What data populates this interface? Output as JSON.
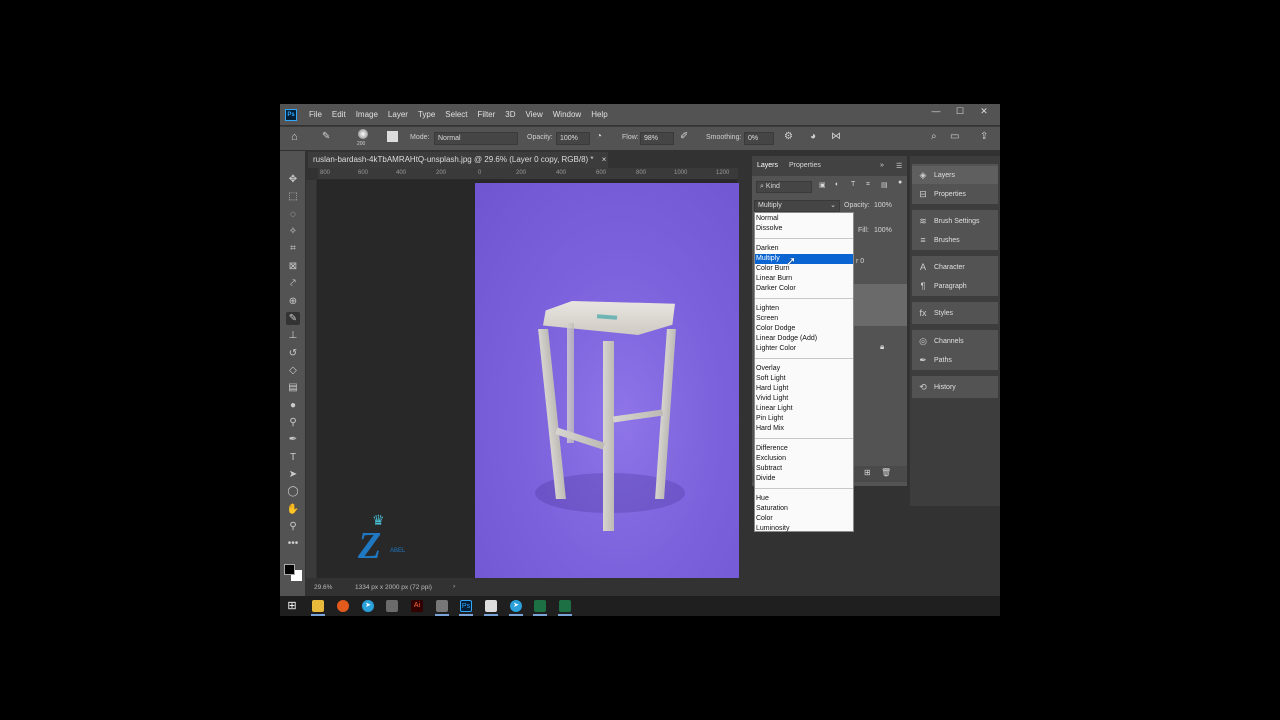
{
  "app": {
    "logo": "Ps",
    "menu": [
      "File",
      "Edit",
      "Image",
      "Layer",
      "Type",
      "Select",
      "Filter",
      "3D",
      "View",
      "Window",
      "Help"
    ],
    "window_controls": [
      "—",
      "☐",
      "✕"
    ]
  },
  "options_bar": {
    "brush_size": "200",
    "mode_label": "Mode:",
    "mode_value": "Normal",
    "opacity_label": "Opacity:",
    "opacity_value": "100%",
    "flow_label": "Flow:",
    "flow_value": "98%",
    "smoothing_label": "Smoothing:",
    "smoothing_value": "0%"
  },
  "document": {
    "tab_title": "ruslan-bardash-4kTbAMRAHtQ-unsplash.jpg @ 29.6% (Layer 0 copy, RGB/8) *",
    "tab_close": "×",
    "ruler_marks": [
      "800",
      "600",
      "400",
      "200",
      "0",
      "200",
      "400",
      "600",
      "800",
      "1000",
      "1200"
    ],
    "zoom": "29.6%",
    "dimensions": "1334 px x 2000 px (72 ppi)"
  },
  "layers_panel": {
    "tabs": [
      "Layers",
      "Properties"
    ],
    "kind_label": "Kind",
    "blend_mode": "Multiply",
    "opacity_label": "Opacity:",
    "opacity_value": "100%",
    "fill_label": "Fill:",
    "fill_value": "100%",
    "partial_layer_text": "r 0"
  },
  "blend_modes": {
    "groups": [
      [
        "Normal",
        "Dissolve"
      ],
      [
        "Darken",
        "Multiply",
        "Color Burn",
        "Linear Burn",
        "Darker Color"
      ],
      [
        "Lighten",
        "Screen",
        "Color Dodge",
        "Linear Dodge (Add)",
        "Lighter Color"
      ],
      [
        "Overlay",
        "Soft Light",
        "Hard Light",
        "Vivid Light",
        "Linear Light",
        "Pin Light",
        "Hard Mix"
      ],
      [
        "Difference",
        "Exclusion",
        "Subtract",
        "Divide"
      ],
      [
        "Hue",
        "Saturation",
        "Color",
        "Luminosity"
      ]
    ],
    "selected": "Multiply"
  },
  "right_dock": {
    "items": [
      "Layers",
      "Properties",
      "Brush Settings",
      "Brushes",
      "Character",
      "Paragraph",
      "Styles",
      "Channels",
      "Paths",
      "History"
    ]
  },
  "watermark": {
    "text": "ABEL"
  },
  "colors": {
    "canvas_purple": "#7c62dc",
    "selection_blue": "#0a64d2",
    "panel_gray": "#535353",
    "workspace": "#282828"
  }
}
